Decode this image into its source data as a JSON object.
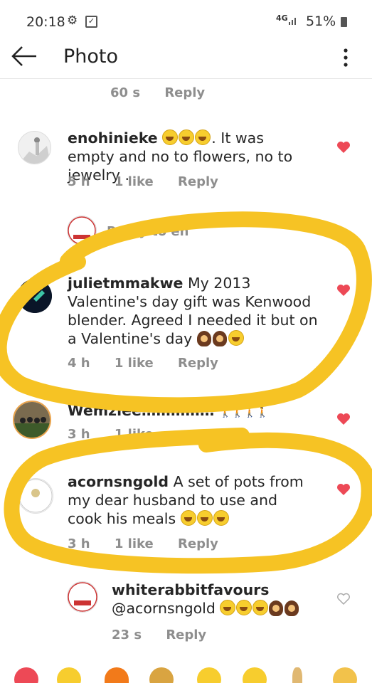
{
  "status_bar": {
    "time": "20:18",
    "network": "4G",
    "battery": "51%",
    "gear_icon": "gear-icon",
    "notification_icon": "checkbox-notification-icon"
  },
  "header": {
    "title": "Photo",
    "back_icon": "back-arrow-icon",
    "menu_icon": "more-vertical-icon"
  },
  "top_meta": {
    "time": "60 s",
    "reply": "Reply"
  },
  "comments": [
    {
      "username": "enohinieke",
      "text": ". It was empty and no to flowers, no to jewelry .",
      "time": "5 h",
      "likes": "1 like",
      "reply": "Reply",
      "liked": true
    },
    {
      "username": "julietmmakwe",
      "text": "My 2013 Valentine's day gift was Kenwood blender. Agreed I needed it but on a Valentine's day",
      "time": "4 h",
      "likes": "1 like",
      "reply": "Reply",
      "liked": true
    },
    {
      "username": "wemzie",
      "text": "Wemziee……………",
      "time": "3 h",
      "likes": "1 like",
      "reply": "Reply",
      "liked": true
    },
    {
      "username": "acornsngold",
      "text": "A set of pots from my dear husband to use and cook his meals",
      "time": "3 h",
      "likes": "1 like",
      "reply": "Reply",
      "liked": true
    },
    {
      "username": "whiterabbitfavours",
      "text": "@acornsngold",
      "time": "23 s",
      "reply": "Reply",
      "liked": false
    }
  ],
  "reply_prompt": "Reply to en",
  "colors": {
    "like_red": "#ed4956",
    "highlight_yellow": "#f6c324",
    "meta_gray": "#8e8e8e"
  }
}
